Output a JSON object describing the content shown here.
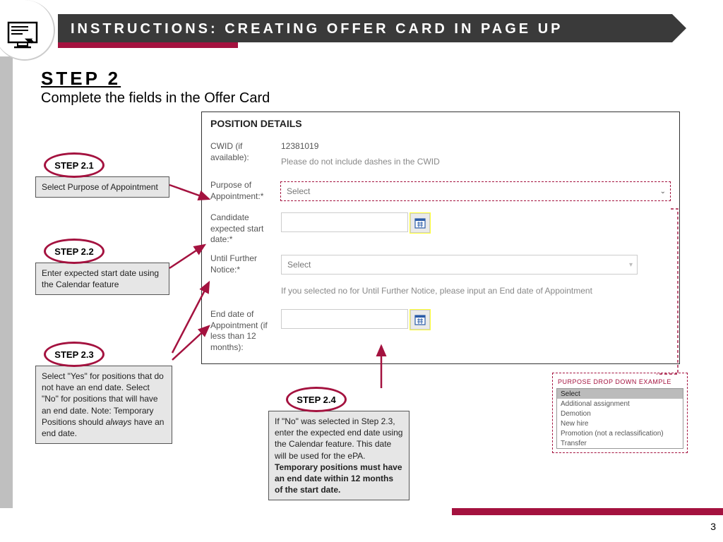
{
  "header": {
    "title": "INSTRUCTIONS: CREATING OFFER CARD IN PAGE UP"
  },
  "step": {
    "num": "STEP 2",
    "desc": "Complete the fields in the Offer Card"
  },
  "form": {
    "title": "POSITION DETAILS",
    "cwid_label": "CWID (if available):",
    "cwid_value": "12381019",
    "cwid_note": "Please do not include dashes in the CWID",
    "purpose_label": "Purpose of Appointment:*",
    "purpose_value": "Select",
    "start_label": "Candidate expected start date:*",
    "ufn_label": "Until Further Notice:*",
    "ufn_value": "Select",
    "ufn_note": "If you selected no for Until Further Notice, please input an End date of Appointment",
    "end_label": "End date of Appointment (if less than 12 months):"
  },
  "callouts": {
    "s21_label": "STEP 2.1",
    "s21_text": "Select Purpose of Appointment",
    "s22_label": "STEP 2.2",
    "s22_text": "Enter expected start date using the Calendar feature",
    "s23_label": "STEP 2.3",
    "s23_text": "Select \"Yes\" for positions that do not have an end date. Select \"No\" for positions that will have an end date. Note: Temporary Positions should ",
    "s23_em": "always",
    "s23_tail": " have an end date.",
    "s24_label": "STEP 2.4",
    "s24_text": "If \"No\" was selected in Step 2.3, enter the expected end date using the Calendar feature.  This date will be used for the ePA.  ",
    "s24_bold": "Temporary positions must have an end date within 12 months of the start date."
  },
  "dropdown": {
    "title": "PURPOSE DROP DOWN EXAMPLE",
    "items": [
      "Select",
      "Additional assignment",
      "Demotion",
      "New hire",
      "Promotion (not a reclassification)",
      "Transfer"
    ]
  },
  "page": "3"
}
